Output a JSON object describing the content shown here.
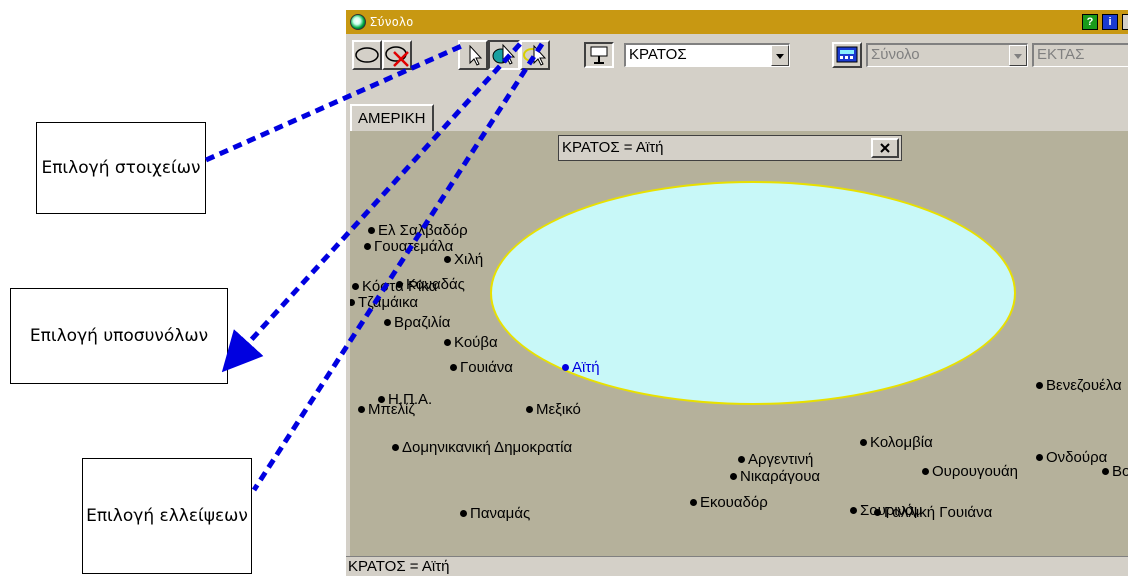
{
  "window": {
    "title": "Σύνολο",
    "title_buttons": [
      {
        "icon": "help-icon",
        "label": "?",
        "color": "#1a9a1a"
      },
      {
        "icon": "info-icon",
        "label": "i",
        "color": "#1a3ad0"
      }
    ]
  },
  "toolbar": {
    "tools": [
      {
        "name": "ellipse-tool",
        "icon": "ellipse-icon"
      },
      {
        "name": "delete-ellipse-tool",
        "icon": "delete-ellipse-icon"
      },
      {
        "name": "select-elements-tool",
        "icon": "pointer-icon"
      },
      {
        "name": "select-subsets-tool",
        "icon": "subset-pointer-icon"
      },
      {
        "name": "select-ellipses-tool",
        "icon": "ellipse-pointer-icon"
      }
    ],
    "attribute_select": {
      "value": "ΚΡΑΤΟΣ",
      "icon": "display-icon"
    },
    "set_select": {
      "value": "Σύνολο",
      "icon": "calculator-icon"
    },
    "measure_select": {
      "value": "ΕΚΤΑΣ"
    }
  },
  "tabs": [
    {
      "label": "ΑΜΕΡΙΚΗ",
      "active": true
    }
  ],
  "filter": {
    "text": "ΚΡΑΤΟΣ = Αϊτή",
    "close_label": "✕"
  },
  "map": {
    "background": "#b5b19b",
    "ellipse_fill": "#c8f8f8",
    "ellipse_border": "#e8e000",
    "countries": [
      {
        "label": "Ελ Σαλβαδόρ"
      },
      {
        "label": "Γουατεμάλα"
      },
      {
        "label": "Χιλή"
      },
      {
        "label": "Καναδάς"
      },
      {
        "label": "Κόστα Ρίκα"
      },
      {
        "label": "Τζαμάικα"
      },
      {
        "label": "Βραζιλία"
      },
      {
        "label": "Κούβα"
      },
      {
        "label": "Γουιάνα"
      },
      {
        "label": "Αϊτή",
        "selected": true
      },
      {
        "label": "Η.Π.Α."
      },
      {
        "label": "Μπελίζ"
      },
      {
        "label": "Μεξικό"
      },
      {
        "label": "Δομηνικανική Δημοκρατία"
      },
      {
        "label": "Κολομβία"
      },
      {
        "label": "Αργεντινή"
      },
      {
        "label": "Νικαράγουα"
      },
      {
        "label": "Ουρουγουάη"
      },
      {
        "label": "Ονδούρα"
      },
      {
        "label": "Βολιβία"
      },
      {
        "label": "Βενεζουέλα"
      },
      {
        "label": "Παναμάς"
      },
      {
        "label": "Εκουαδόρ"
      },
      {
        "label": "Σουρινάμ"
      },
      {
        "label": "Γαλλική Γουιάνα"
      }
    ]
  },
  "status": {
    "text": "ΚΡΑΤΟΣ = Αϊτή"
  },
  "callouts": {
    "select_elements": "Επιλογή στοιχείων",
    "select_subsets": "Επιλογή υποσυνόλων",
    "select_ellipses": "Επιλογή ελλείψεων"
  },
  "colors": {
    "title_bar": "#c89812",
    "arrow": "#0000e0",
    "selected_country": "#0000e0"
  }
}
